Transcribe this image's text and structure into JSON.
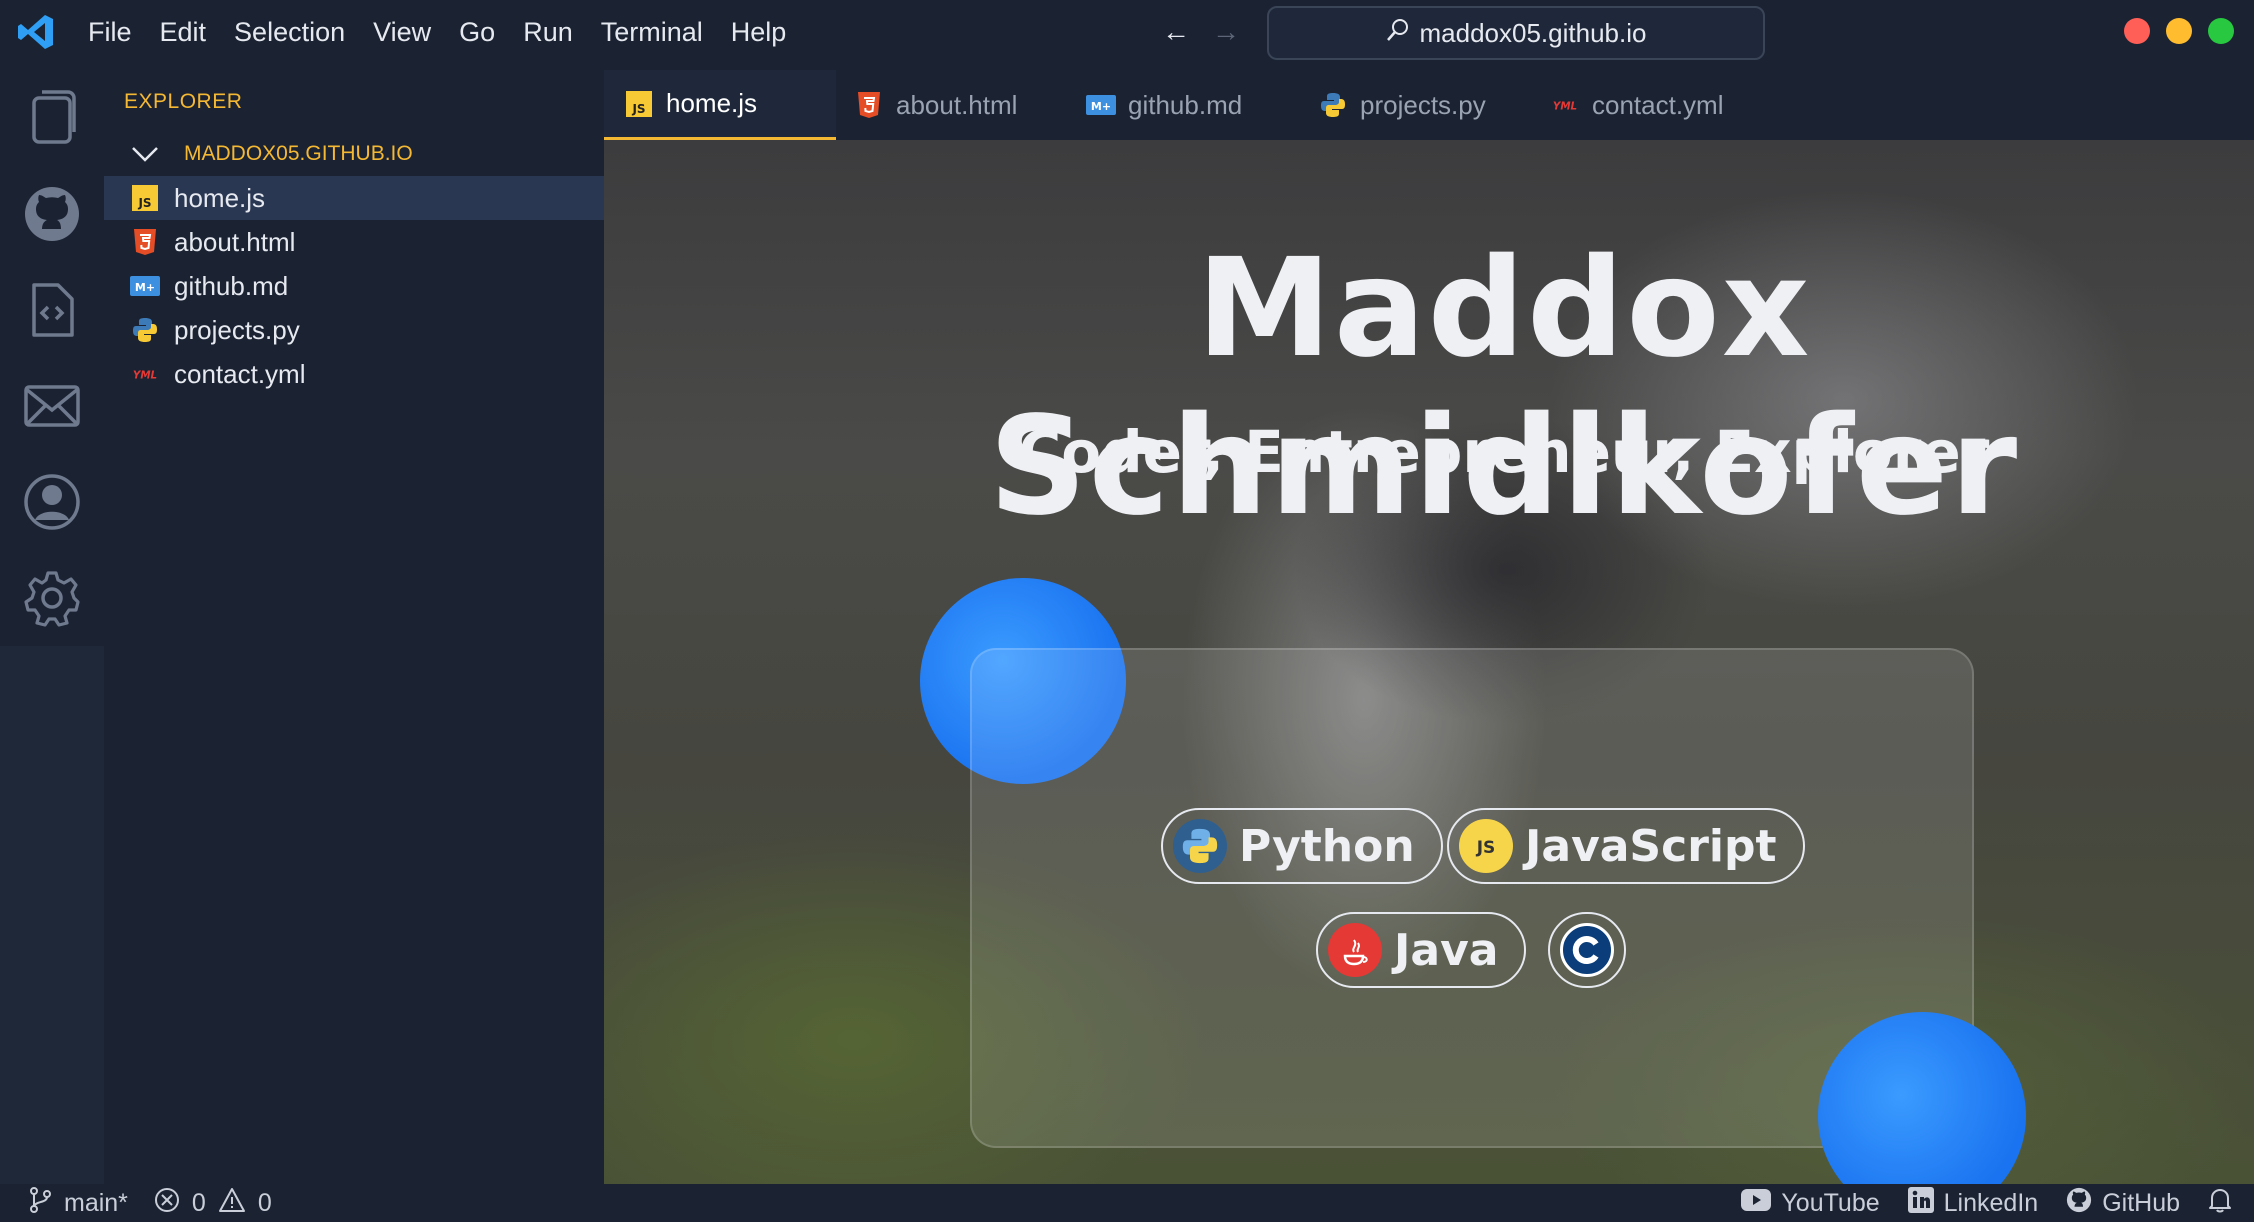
{
  "menu": [
    "File",
    "Edit",
    "Selection",
    "View",
    "Go",
    "Run",
    "Terminal",
    "Help"
  ],
  "search": {
    "text": "maddox05.github.io"
  },
  "sidebar": {
    "title": "EXPLORER",
    "folder": "MADDOX05.GITHUB.IO",
    "files": [
      {
        "name": "home.js",
        "icon": "javascript-file-icon",
        "active": true
      },
      {
        "name": "about.html",
        "icon": "html5-file-icon"
      },
      {
        "name": "github.md",
        "icon": "markdown-file-icon"
      },
      {
        "name": "projects.py",
        "icon": "python-file-icon"
      },
      {
        "name": "contact.yml",
        "icon": "yaml-file-icon"
      }
    ]
  },
  "tabs": [
    {
      "label": "home.js",
      "active": true
    },
    {
      "label": "about.html"
    },
    {
      "label": "github.md"
    },
    {
      "label": "projects.py"
    },
    {
      "label": "contact.yml"
    }
  ],
  "hero": {
    "title": "Maddox Schmidlkofer",
    "subtitle": "Coder, Entrepreneur, Explorer",
    "skills": [
      {
        "label": "Python",
        "icon": "python-icon"
      },
      {
        "label": "JavaScript",
        "icon": "javascript-icon"
      },
      {
        "label": "Java",
        "icon": "java-icon"
      },
      {
        "label": "",
        "icon": "c-language-icon"
      }
    ]
  },
  "status": {
    "branch": "main*",
    "errors": "0",
    "warnings": "0",
    "links": [
      "YouTube",
      "LinkedIn",
      "GitHub"
    ]
  },
  "colors": {
    "accent": "#f5b833",
    "blob": "#1a73f0",
    "background": "#1b2333"
  }
}
